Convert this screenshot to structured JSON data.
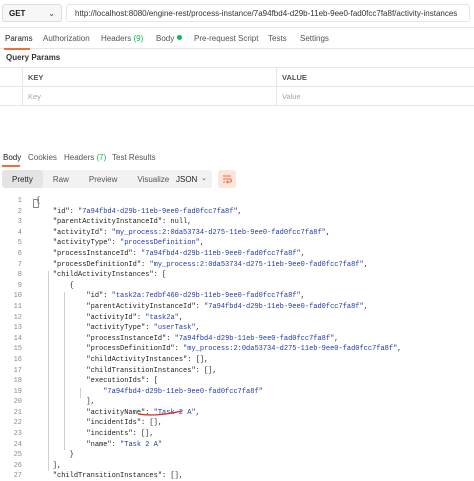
{
  "request": {
    "method": "GET",
    "method_chevron": "⌄",
    "url": "http://localhost:8080/engine-rest/process-instance/7a94fbd4-d29b-11eb-9ee0-fad0fcc7fa8f/activity-instances"
  },
  "request_tabs": [
    {
      "label": "Params",
      "active": true
    },
    {
      "label": "Authorization"
    },
    {
      "label": "Headers",
      "count": "(9)"
    },
    {
      "label": "Body",
      "dot": true
    },
    {
      "label": "Pre-request Script"
    },
    {
      "label": "Tests"
    },
    {
      "label": "Settings"
    }
  ],
  "query_params": {
    "title": "Query Params",
    "columns": [
      "KEY",
      "VALUE"
    ],
    "key_placeholder": "Key",
    "value_placeholder": "Value"
  },
  "response_tabs": [
    {
      "label": "Body",
      "active": true
    },
    {
      "label": "Cookies"
    },
    {
      "label": "Headers",
      "count": "(7)"
    },
    {
      "label": "Test Results"
    }
  ],
  "toolbar": {
    "views": [
      "Pretty",
      "Raw",
      "Preview",
      "Visualize"
    ],
    "active_view": "Pretty",
    "format": "JSON",
    "format_chevron": "⌄"
  },
  "colors": {
    "accent": "#f26b3a",
    "count_green": "#0cbb52",
    "string_blue": "#1f3aa8",
    "annotation_red": "#d9262b"
  },
  "code_lines": [
    "{",
    "    \"id\": \"7a94fbd4-d29b-11eb-9ee0-fad0fcc7fa8f\",",
    "    \"parentActivityInstanceId\": null,",
    "    \"activityId\": \"my_process:2:0da53734-d275-11eb-9ee0-fad0fcc7fa8f\",",
    "    \"activityType\": \"processDefinition\",",
    "    \"processInstanceId\": \"7a94fbd4-d29b-11eb-9ee0-fad0fcc7fa8f\",",
    "    \"processDefinitionId\": \"my_process:2:0da53734-d275-11eb-9ee0-fad0fcc7fa8f\",",
    "    \"childActivityInstances\": [",
    "        {",
    "            \"id\": \"task2a:7edbf460-d29b-11eb-9ee0-fad0fcc7fa8f\",",
    "            \"parentActivityInstanceId\": \"7a94fbd4-d29b-11eb-9ee0-fad0fcc7fa8f\",",
    "            \"activityId\": \"task2a\",",
    "            \"activityType\": \"userTask\",",
    "            \"processInstanceId\": \"7a94fbd4-d29b-11eb-9ee0-fad0fcc7fa8f\",",
    "            \"processDefinitionId\": \"my_process:2:0da53734-d275-11eb-9ee0-fad0fcc7fa8f\",",
    "            \"childActivityInstances\": [],",
    "            \"childTransitionInstances\": [],",
    "            \"executionIds\": [",
    "                \"7a94fbd4-d29b-11eb-9ee0-fad0fcc7fa8f\"",
    "            ],",
    "            \"activityName\": \"Task 2 A\",",
    "            \"incidentIds\": [],",
    "            \"incidents\": [],",
    "            \"name\": \"Task 2 A\"",
    "        }",
    "    ],",
    "    \"childTransitionInstances\": [],"
  ]
}
